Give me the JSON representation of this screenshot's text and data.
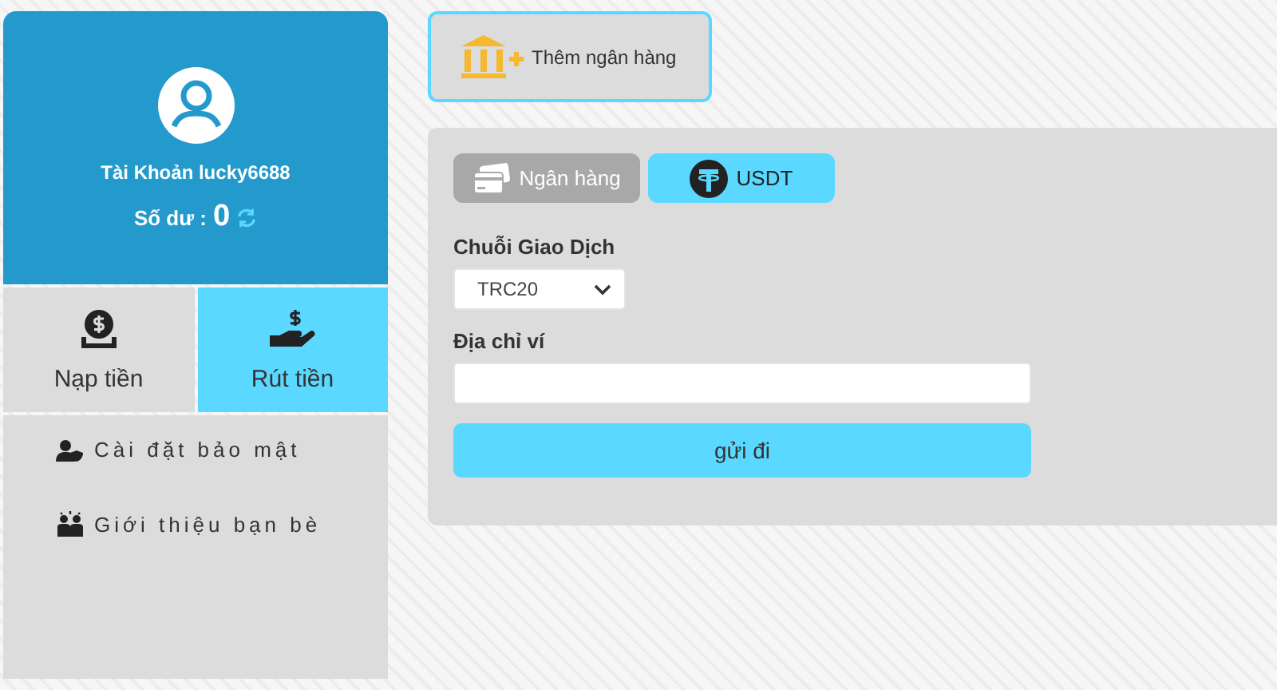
{
  "profile": {
    "account": "Tài Khoản lucky6688",
    "balance_label": "Số dư :",
    "balance": "0"
  },
  "actions": [
    {
      "label": "Nạp tiền",
      "kind": "deposit",
      "selected": false
    },
    {
      "label": "Rút tiền",
      "kind": "withdraw",
      "selected": true
    }
  ],
  "menu": [
    {
      "label": "Cài đặt bảo mật",
      "kind": "security"
    },
    {
      "label": "Giới thiệu bạn bè",
      "kind": "referral"
    }
  ],
  "add_bank_button": "Thêm ngân hàng",
  "tabs": [
    {
      "label": "Ngân hàng",
      "kind": "bank",
      "selected": false
    },
    {
      "label": "USDT",
      "kind": "usdt",
      "selected": true
    }
  ],
  "form": {
    "chain_label": "Chuỗi Giao Dịch",
    "chain_value": "TRC20",
    "address_label": "Địa chỉ ví",
    "submit": "gửi đi"
  }
}
